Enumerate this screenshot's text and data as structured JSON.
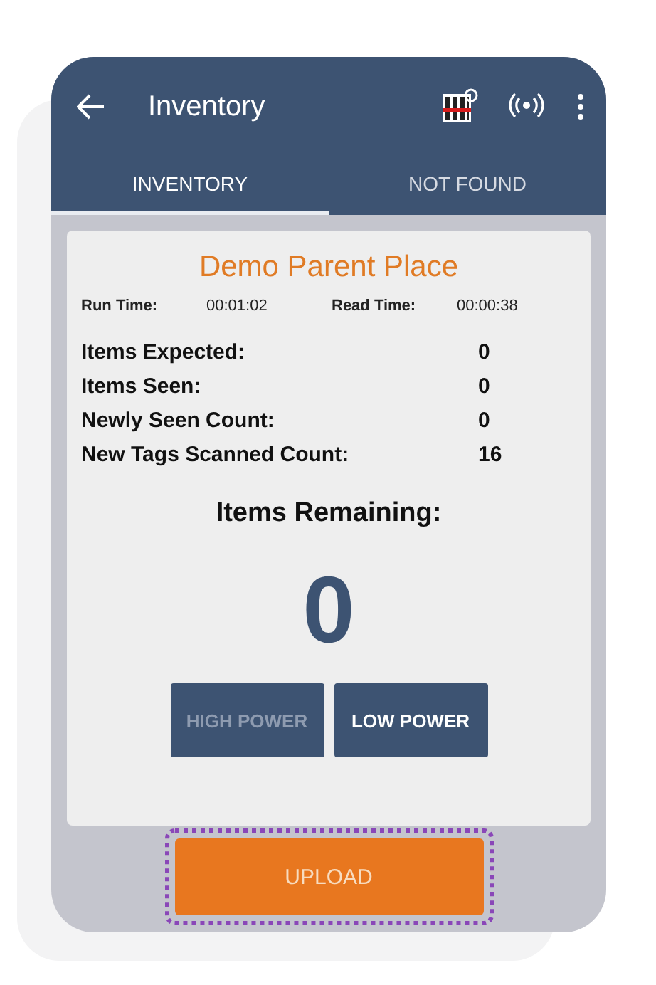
{
  "app_bar": {
    "title": "Inventory"
  },
  "tabs": [
    {
      "label": "INVENTORY",
      "selected": true
    },
    {
      "label": "NOT FOUND",
      "selected": false
    }
  ],
  "card": {
    "title": "Demo Parent Place",
    "times": [
      {
        "label": "Run Time:",
        "value": "00:01:02"
      },
      {
        "label": "Read Time:",
        "value": "00:00:38"
      }
    ],
    "stats": [
      {
        "label": "Items Expected:",
        "value": "0"
      },
      {
        "label": "Items Seen:",
        "value": "0"
      },
      {
        "label": "Newly Seen Count:",
        "value": "0"
      },
      {
        "label": "New Tags Scanned Count:",
        "value": "16"
      }
    ],
    "remaining_label": "Items Remaining:",
    "remaining_value": "0",
    "power_buttons": [
      {
        "label": "HIGH POWER",
        "disabled": true
      },
      {
        "label": "LOW POWER",
        "disabled": false
      }
    ]
  },
  "upload_button": {
    "label": "UPLOAD",
    "highlighted": true
  }
}
